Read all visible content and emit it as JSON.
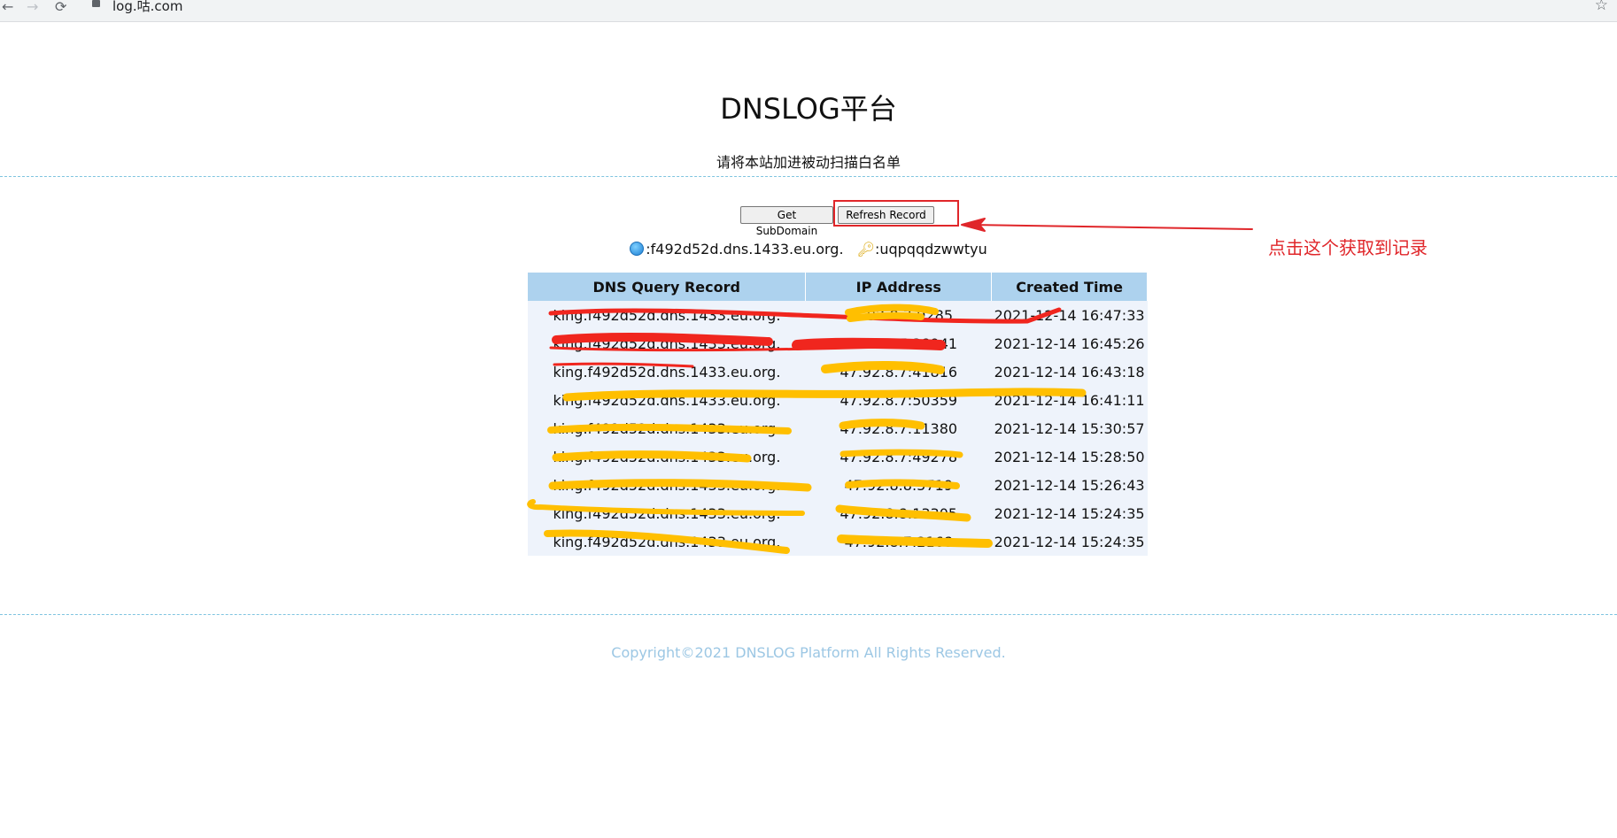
{
  "browser": {
    "back_icon": "←",
    "forward_icon": "→",
    "reload_icon": "⟳",
    "url": "log.咕.com",
    "star_icon": "☆"
  },
  "page": {
    "title": "DNSLOG平台",
    "subtitle": "请将本站加进被动扫描白名单"
  },
  "buttons": {
    "get_subdomain": "Get SubDomain",
    "refresh_record": "Refresh Record"
  },
  "info": {
    "subdomain": ":f492d52d.dns.1433.eu.org.",
    "token": ":uqpqqdzwwtyu"
  },
  "table": {
    "headers": [
      "DNS Query Record",
      "IP Address",
      "Created Time"
    ],
    "rows": [
      {
        "domain": "king.f492d52d.dns.1433.eu.org.",
        "ip": "47.92.8.7:9285",
        "time": "2021-12-14 16:47:33"
      },
      {
        "domain": "king.f492d52d.dns.1433.eu.org.",
        "ip": "47.92.8.7:38941",
        "time": "2021-12-14 16:45:26"
      },
      {
        "domain": "king.f492d52d.dns.1433.eu.org.",
        "ip": "47.92.8.7:41816",
        "time": "2021-12-14 16:43:18"
      },
      {
        "domain": "king.f492d52d.dns.1433.eu.org.",
        "ip": "47.92.8.7:50359",
        "time": "2021-12-14 16:41:11"
      },
      {
        "domain": "king.f492d52d.dns.1433.eu.org.",
        "ip": "47.92.8.7:11380",
        "time": "2021-12-14 15:30:57"
      },
      {
        "domain": "king.f492d52d.dns.1433.eu.org.",
        "ip": "47.92.8.7:49278",
        "time": "2021-12-14 15:28:50"
      },
      {
        "domain": "king.f492d52d.dns.1433.eu.org.",
        "ip": "47.92.8.8:5719",
        "time": "2021-12-14 15:26:43"
      },
      {
        "domain": "king.f492d52d.dns.1433.eu.org.",
        "ip": "47.92.8.8:13305",
        "time": "2021-12-14 15:24:35"
      },
      {
        "domain": "king.f492d52d.dns.1433.eu.org.",
        "ip": "47.92.8.7:2168",
        "time": "2021-12-14 15:24:35"
      }
    ]
  },
  "annotation": {
    "text": "点击这个获取到记录",
    "color": "#e0262a"
  },
  "footer": {
    "copyright": "Copyright©2021 DNSLOG Platform All Rights Reserved."
  },
  "colors": {
    "header_bg": "#add2ee",
    "row_bg": "#eef3fb",
    "dashed_line": "#7fc4e0",
    "footer_text": "#9cc7e4",
    "red_scribble": "#f0261e",
    "yellow_scribble": "#ffbf00"
  }
}
